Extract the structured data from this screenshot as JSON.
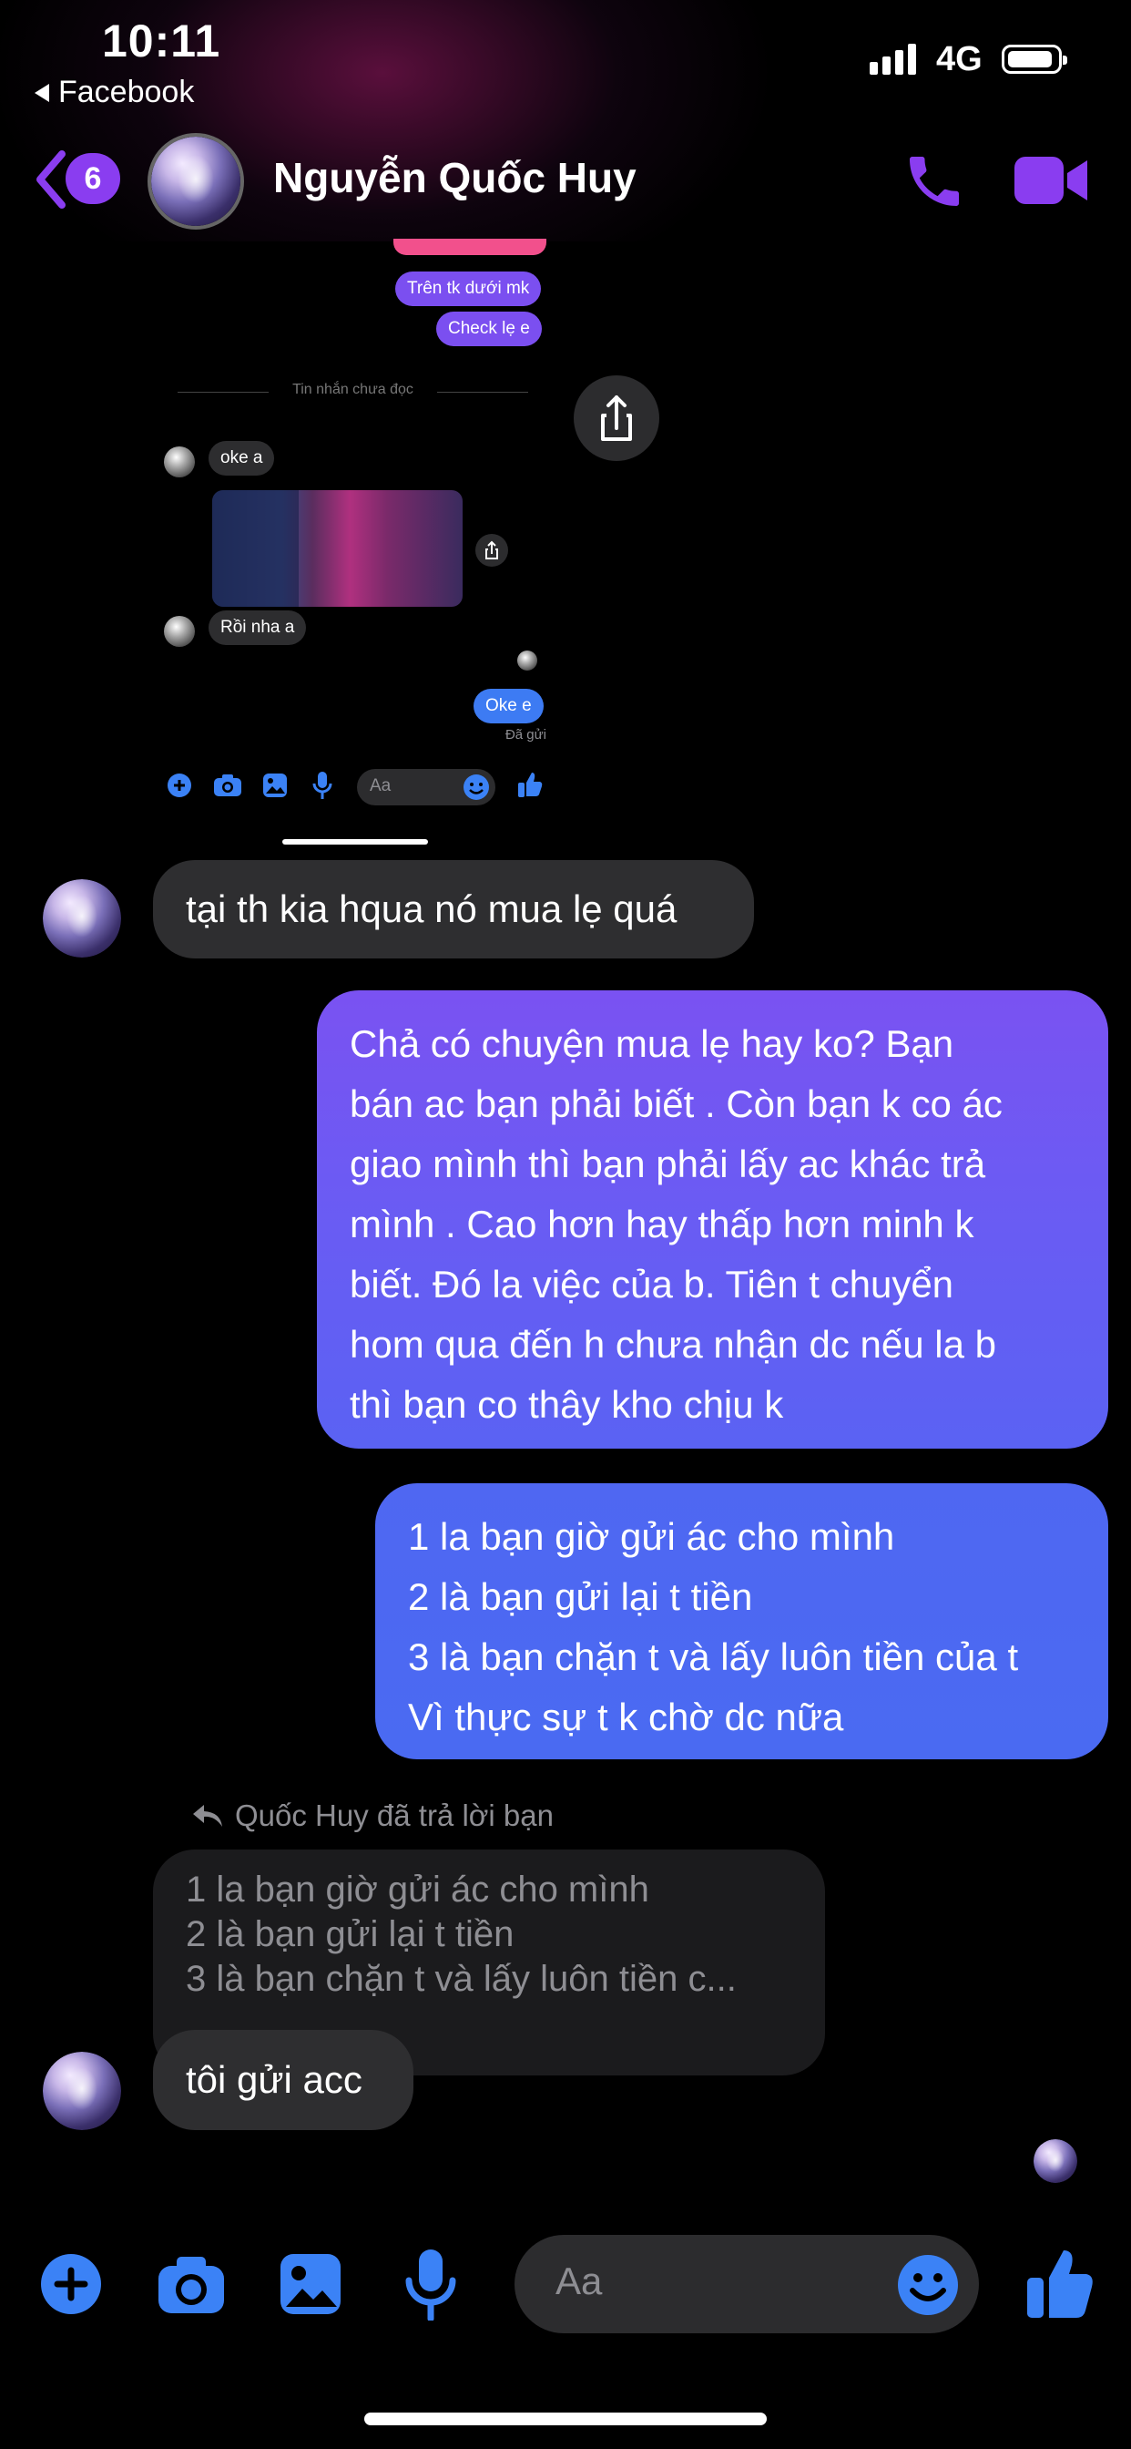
{
  "status_bar": {
    "time": "10:11",
    "back_app": "Facebook",
    "network": "4G"
  },
  "header": {
    "unread_count": "6",
    "contact_name": "Nguyễn Quốc Huy",
    "call_icon": "phone-icon",
    "video_icon": "video-camera-icon",
    "accent_color": "#8a3df0"
  },
  "embedded_screenshot": {
    "bubbles": [
      {
        "text": "Trên tk dưới mk"
      },
      {
        "text": "Check lẹ e"
      }
    ],
    "unread_divider": "Tin nhắn chưa đọc",
    "received": [
      {
        "text": "oke a"
      },
      {
        "text": "Rồi nha a"
      }
    ],
    "sent_reply": "Oke e",
    "sent_status": "Đã gửi",
    "composer_placeholder": "Aa"
  },
  "messages": {
    "m1": "tại th kia hqua nó mua lẹ quá",
    "m2_lines": [
      "Chả có chuyện mua lẹ hay ko? Bạn",
      "bán ac bạn phải biết . Còn bạn k co ác",
      "giao mình thì bạn phải lấy ac khác trả",
      "mình . Cao hơn hay thấp hơn minh k",
      "biết. Đó la việc của b. Tiên t chuyển",
      "hom qua đến h chưa nhận dc nếu la b",
      "thì bạn co thây kho chịu k"
    ],
    "m3_lines": [
      "1 la bạn giờ gửi ác cho mình",
      "2 là bạn gửi lại t tiền",
      "3 là bạn chặn t và lấy luôn tiền của t",
      "Vì thực sự t k chờ dc nữa"
    ],
    "reply_label": "Quốc Huy đã trả lời bạn",
    "quote_lines": [
      "1 la bạn giờ gửi ác cho mình",
      "2 là bạn gửi lại t tiền",
      "3 là bạn chặn t và lấy luôn tiền c..."
    ],
    "m4": "tôi gửi acc"
  },
  "composer": {
    "placeholder": "Aa",
    "accent_color": "#3b82f6"
  }
}
